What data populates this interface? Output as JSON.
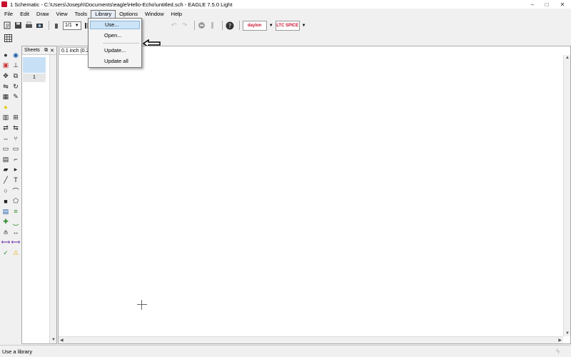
{
  "window": {
    "title": "1 Schematic - C:\\Users\\Joseph\\Documents\\eagle\\Hello-Echo\\untitled.sch - EAGLE 7.5.0 Light",
    "controls": {
      "minimize": "–",
      "maximize": "□",
      "close": "✕"
    }
  },
  "menu": [
    {
      "label": "File"
    },
    {
      "label": "Edit"
    },
    {
      "label": "Draw"
    },
    {
      "label": "View"
    },
    {
      "label": "Tools"
    },
    {
      "label": "Library",
      "active": true
    },
    {
      "label": "Options"
    },
    {
      "label": "Window"
    },
    {
      "label": "Help"
    }
  ],
  "toolbar": {
    "sheet_combo_value": "1/1",
    "brand1": "daylon",
    "brand2": "LTC SPICE"
  },
  "library_menu": {
    "items": [
      {
        "label": "Use...",
        "highlighted": true
      },
      {
        "label": "Open..."
      },
      {
        "label": "Update..."
      },
      {
        "label": "Update all"
      }
    ]
  },
  "sheets_panel": {
    "title": "Sheets",
    "sheet_number": "1"
  },
  "canvas": {
    "coord_display": "0.1 inch (0.2"
  },
  "status": {
    "text": "Use a library"
  },
  "left_tools": [
    "info-icon",
    "eye-icon",
    "layers-icon",
    "mark-icon",
    "move-icon",
    "copy-icon",
    "mirror-icon",
    "rotate-icon",
    "group-icon",
    "change-icon",
    "paste-icon",
    "blank-icon",
    "delete-icon",
    "add-icon",
    "pinswap-icon",
    "gateswap-icon",
    "replace-icon",
    "split-icon",
    "name-icon",
    "value-icon",
    "smash-icon",
    "miter-icon",
    "invoke-icon",
    "optimize-icon",
    "wire-icon",
    "text-icon",
    "circle-icon",
    "arc-icon",
    "rect-icon",
    "polygon-icon",
    "bus-icon",
    "net-icon",
    "junction-icon",
    "label-icon",
    "attribute-icon",
    "dimension-icon",
    "frame-icon",
    "frame2-icon",
    "erc-icon",
    "errors-icon"
  ]
}
